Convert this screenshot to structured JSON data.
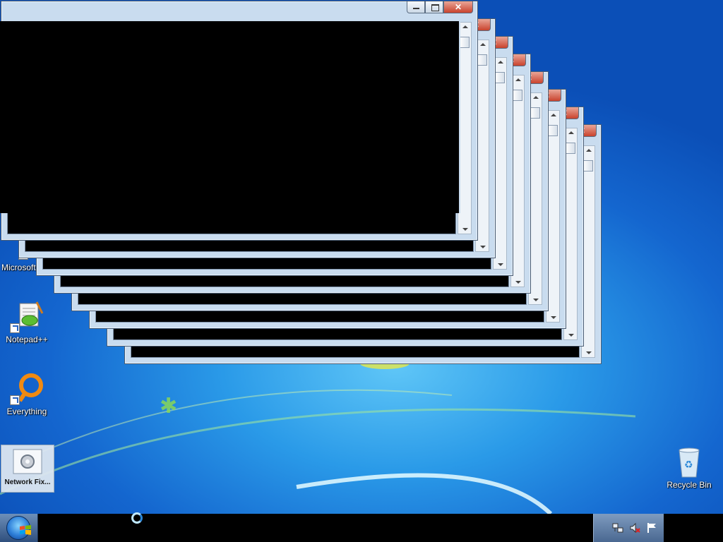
{
  "desktop": {
    "icons": [
      {
        "label": "Microsoft Visual Studio...",
        "icon": "visual-studio-icon"
      },
      {
        "label": "Notepad++",
        "icon": "notepad-plus-plus-icon"
      },
      {
        "label": "Everything",
        "icon": "everything-search-icon"
      },
      {
        "label": "Network Fix...",
        "icon": "network-fix-icon"
      },
      {
        "label": "Recycle Bin",
        "icon": "recycle-bin-icon"
      }
    ]
  },
  "windows": {
    "count": 8,
    "title_buttons": {
      "close": "✕"
    }
  },
  "taskbar": {
    "start_icon": "windows-start-orb",
    "tray_icons": [
      "network-icon",
      "volume-muted-icon",
      "action-center-flag-icon"
    ]
  },
  "colors": {
    "window_frame": "#c9dcef",
    "close_button": "#c9432d",
    "taskbar": "#000000",
    "desktop_blue": "#1466cf"
  }
}
